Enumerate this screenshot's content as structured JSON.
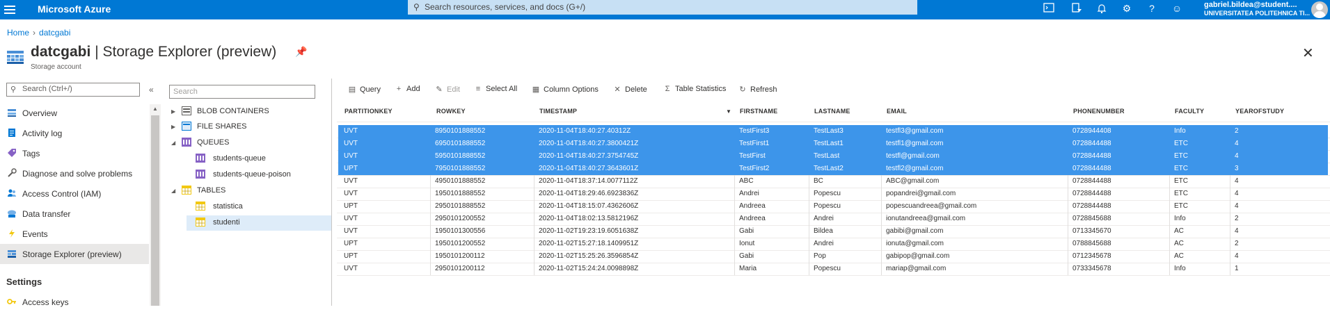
{
  "topbar": {
    "brand": "Microsoft Azure",
    "search_placeholder": "Search resources, services, and docs (G+/)",
    "user_name": "gabriel.bildea@student....",
    "user_org": "UNIVERSITATEA POLITEHNICA TI...",
    "icons": [
      "cloud-shell-icon",
      "directory-filter-icon",
      "notifications-icon",
      "settings-icon",
      "help-icon",
      "feedback-icon"
    ]
  },
  "breadcrumb": {
    "home": "Home",
    "current": "datcgabi"
  },
  "header": {
    "title_bold": "datcgabi",
    "title_rest": " | Storage Explorer (preview)",
    "subtitle": "Storage account"
  },
  "nav": {
    "search_placeholder": "Search (Ctrl+/)",
    "items": [
      {
        "label": "Overview",
        "icon": "overview-icon"
      },
      {
        "label": "Activity log",
        "icon": "activity-log-icon"
      },
      {
        "label": "Tags",
        "icon": "tag-icon"
      },
      {
        "label": "Diagnose and solve problems",
        "icon": "wrench-icon"
      },
      {
        "label": "Access Control (IAM)",
        "icon": "people-icon"
      },
      {
        "label": "Data transfer",
        "icon": "cloud-transfer-icon"
      },
      {
        "label": "Events",
        "icon": "lightning-icon"
      },
      {
        "label": "Storage Explorer (preview)",
        "icon": "storage-explorer-icon"
      }
    ],
    "section_settings": "Settings",
    "section_items": [
      {
        "label": "Access keys",
        "icon": "key-icon"
      }
    ]
  },
  "tree": {
    "search_placeholder": "Search",
    "blob_containers": "BLOB CONTAINERS",
    "file_shares": "FILE SHARES",
    "queues": "QUEUES",
    "queue_items": [
      "students-queue",
      "students-queue-poison"
    ],
    "tables": "TABLES",
    "table_items": [
      "statistica",
      "studenti"
    ]
  },
  "toolbar": {
    "query": "Query",
    "add": "Add",
    "edit": "Edit",
    "select_all": "Select All",
    "column_options": "Column Options",
    "delete": "Delete",
    "table_statistics": "Table Statistics",
    "refresh": "Refresh"
  },
  "grid": {
    "columns": [
      "PARTITIONKEY",
      "ROWKEY",
      "TIMESTAMP",
      "FIRSTNAME",
      "LASTNAME",
      "EMAIL",
      "PHONENUMBER",
      "FACULTY",
      "YEAROFSTUDY"
    ],
    "rows": [
      {
        "selected": true,
        "cells": [
          "UVT",
          "8950101888552",
          "2020-11-04T18:40:27.40312Z",
          "TestFirst3",
          "TestLast3",
          "testfl3@gmail.com",
          "0728944408",
          "Info",
          "2"
        ]
      },
      {
        "selected": true,
        "cells": [
          "UVT",
          "6950101888552",
          "2020-11-04T18:40:27.3800421Z",
          "TestFirst1",
          "TestLast1",
          "testfl1@gmail.com",
          "0728844488",
          "ETC",
          "4"
        ]
      },
      {
        "selected": true,
        "cells": [
          "UVT",
          "5950101888552",
          "2020-11-04T18:40:27.3754745Z",
          "TestFirst",
          "TestLast",
          "testfl@gmail.com",
          "0728844488",
          "ETC",
          "4"
        ]
      },
      {
        "selected": true,
        "cells": [
          "UPT",
          "7950101888552",
          "2020-11-04T18:40:27.3643601Z",
          "TestFirst2",
          "TestLast2",
          "testfl2@gmail.com",
          "0728844488",
          "ETC",
          "3"
        ]
      },
      {
        "selected": false,
        "cells": [
          "UVT",
          "4950101888552",
          "2020-11-04T18:37:14.0077112Z",
          "ABC",
          "BC",
          "ABC@gmail.com",
          "0728844488",
          "ETC",
          "4"
        ]
      },
      {
        "selected": false,
        "cells": [
          "UVT",
          "1950101888552",
          "2020-11-04T18:29:46.6923836Z",
          "Andrei",
          "Popescu",
          "popandrei@gmail.com",
          "0728844488",
          "ETC",
          "4"
        ]
      },
      {
        "selected": false,
        "cells": [
          "UPT",
          "2950101888552",
          "2020-11-04T18:15:07.4362606Z",
          "Andreea",
          "Popescu",
          "popescuandreea@gmail.com",
          "0728844488",
          "ETC",
          "4"
        ]
      },
      {
        "selected": false,
        "cells": [
          "UVT",
          "2950101200552",
          "2020-11-04T18:02:13.5812196Z",
          "Andreea",
          "Andrei",
          "ionutandreea@gmail.com",
          "0728845688",
          "Info",
          "2"
        ]
      },
      {
        "selected": false,
        "cells": [
          "UVT",
          "1950101300556",
          "2020-11-02T19:23:19.6051638Z",
          "Gabi",
          "Bildea",
          "gabibi@gmail.com",
          "0713345670",
          "AC",
          "4"
        ]
      },
      {
        "selected": false,
        "cells": [
          "UPT",
          "1950101200552",
          "2020-11-02T15:27:18.1409951Z",
          "Ionut",
          "Andrei",
          "ionuta@gmail.com",
          "0788845688",
          "AC",
          "2"
        ]
      },
      {
        "selected": false,
        "cells": [
          "UPT",
          "1950101200112",
          "2020-11-02T15:25:26.3596854Z",
          "Gabi",
          "Pop",
          "gabipop@gmail.com",
          "0712345678",
          "AC",
          "4"
        ]
      },
      {
        "selected": false,
        "cells": [
          "UVT",
          "2950101200112",
          "2020-11-02T15:24:24.0098898Z",
          "Maria",
          "Popescu",
          "mariap@gmail.com",
          "0733345678",
          "Info",
          "1"
        ]
      }
    ]
  },
  "colors": {
    "azure_blue": "#0078d4",
    "selected_row": "#3d95ea",
    "search_bg": "#c7e0f4"
  }
}
